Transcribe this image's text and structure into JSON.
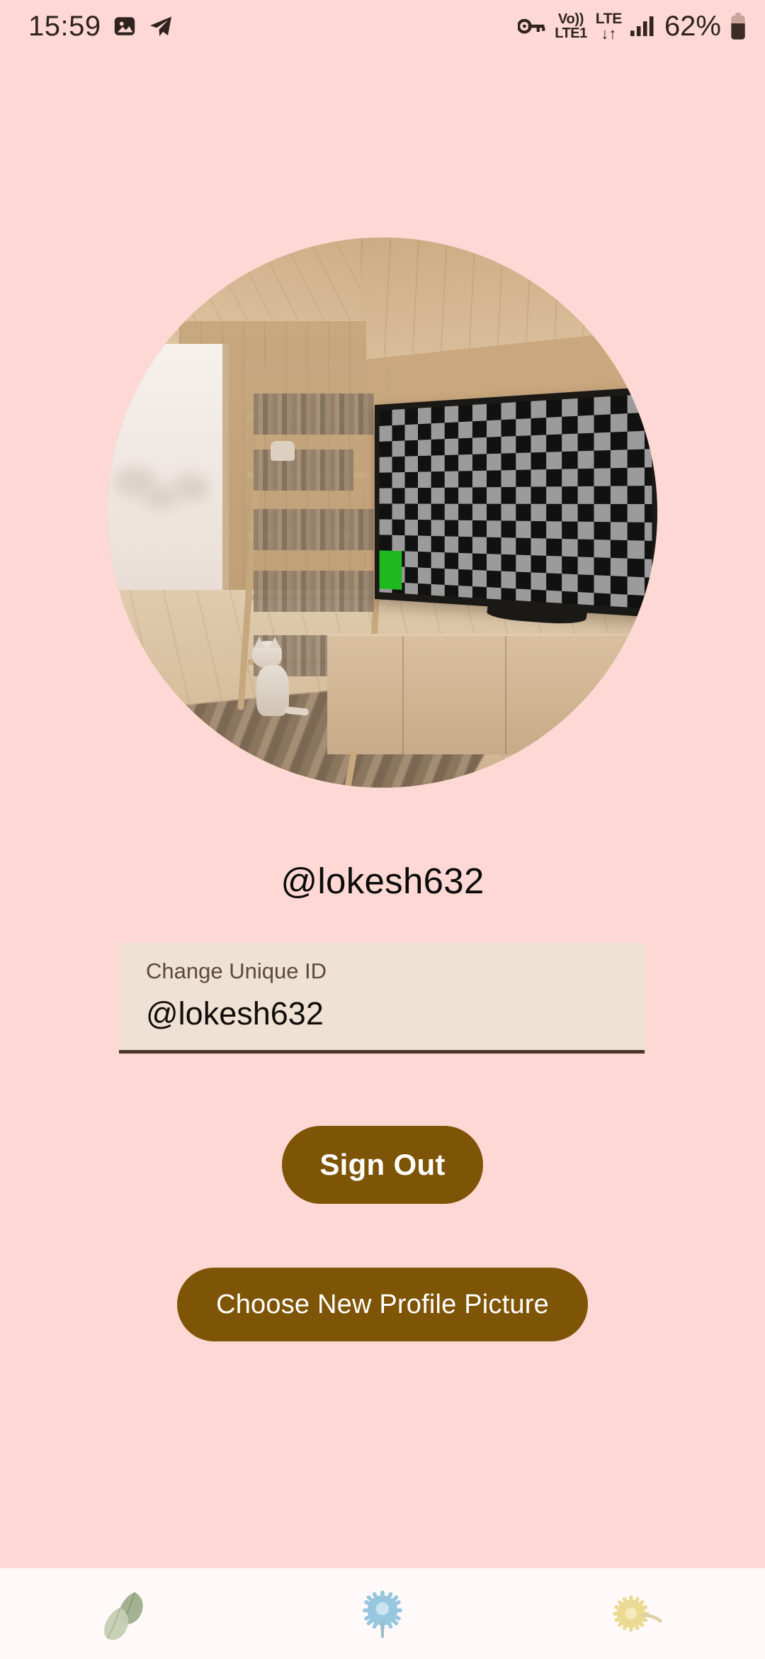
{
  "status_bar": {
    "time": "15:59",
    "battery_percent": "62%",
    "volte_top": "Vo))",
    "volte_bottom": "LTE1",
    "network_type": "LTE",
    "data_arrows": "↓↑",
    "icons": [
      "photo-gallery-icon",
      "telegram-plane-icon",
      "vpn-key-icon",
      "volte-icon",
      "lte-data-icon",
      "signal-bars-icon",
      "battery-icon"
    ]
  },
  "profile": {
    "avatar_alt": "profile-picture",
    "username": "@lokesh632"
  },
  "unique_id_field": {
    "label": "Change Unique ID",
    "value": "@lokesh632",
    "placeholder": "@lokesh632"
  },
  "actions": {
    "sign_out_label": "Sign Out",
    "choose_picture_label": "Choose New Profile Picture"
  },
  "bottom_nav": {
    "items": [
      {
        "name": "leaves-icon"
      },
      {
        "name": "blue-flower-icon"
      },
      {
        "name": "yellow-flower-icon"
      }
    ]
  },
  "colors": {
    "background": "#FDD8D4",
    "button": "#7E5406",
    "button_text": "#FFFFFF",
    "field_background": "#EFE1D4",
    "field_underline": "#4A3526",
    "nav_background": "#FFFAF9",
    "text": "#0B0B0B"
  }
}
